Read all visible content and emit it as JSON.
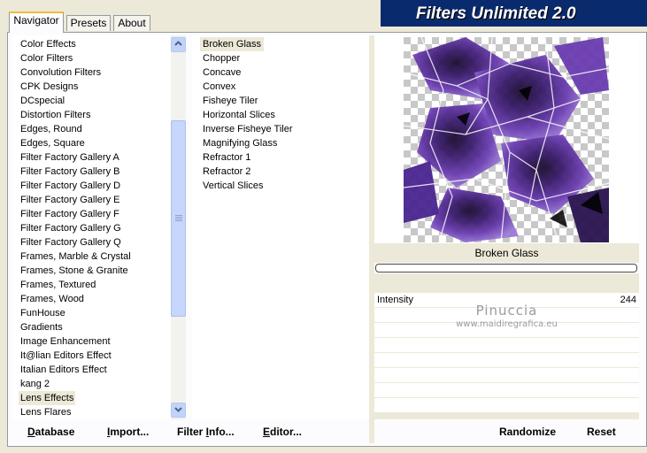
{
  "window": {
    "title": "Filters Unlimited 2.0"
  },
  "tabs": [
    {
      "label": "Navigator",
      "active": true
    },
    {
      "label": "Presets",
      "active": false
    },
    {
      "label": "About",
      "active": false
    }
  ],
  "categories": [
    "Color Effects",
    "Color Filters",
    "Convolution Filters",
    "CPK Designs",
    "DCspecial",
    "Distortion Filters",
    "Edges, Round",
    "Edges, Square",
    "Filter Factory Gallery A",
    "Filter Factory Gallery B",
    "Filter Factory Gallery D",
    "Filter Factory Gallery E",
    "Filter Factory Gallery F",
    "Filter Factory Gallery G",
    "Filter Factory Gallery Q",
    "Frames, Marble & Crystal",
    "Frames, Stone & Granite",
    "Frames, Textured",
    "Frames, Wood",
    "FunHouse",
    "Gradients",
    "Image Enhancement",
    "It@lian Editors Effect",
    "Italian Editors Effect",
    "kang 2",
    "Lens Effects",
    "Lens Flares"
  ],
  "selected_category": "Lens Effects",
  "filters": [
    "Broken Glass",
    "Chopper",
    "Concave",
    "Convex",
    "Fisheye Tiler",
    "Horizontal Slices",
    "Inverse Fisheye Tiler",
    "Magnifying Glass",
    "Refractor 1",
    "Refractor 2",
    "Vertical Slices"
  ],
  "selected_filter": "Broken Glass",
  "preview": {
    "filter_name": "Broken Glass"
  },
  "parameters": [
    {
      "label": "Intensity",
      "value": "244"
    }
  ],
  "watermark": {
    "line1": "Pinuccia",
    "line2": "www.maidiregrafica.eu"
  },
  "buttons": {
    "database": {
      "accel": "D",
      "rest": "atabase"
    },
    "import": {
      "accel": "I",
      "rest": "mport..."
    },
    "filter_info": {
      "pre": "Filter ",
      "accel": "I",
      "rest": "nfo..."
    },
    "editor": {
      "accel": "E",
      "rest": "ditor..."
    },
    "randomize": "Randomize",
    "reset": "Reset"
  },
  "colors": {
    "banner_bg": "#0a2a6e",
    "selection": "#ece9d8",
    "scroll_blue": "#c1d3fb",
    "preview_purple": "#5b2d9c"
  },
  "icons": {
    "scroll_up": "chevron-up-icon",
    "scroll_down": "chevron-down-icon"
  }
}
